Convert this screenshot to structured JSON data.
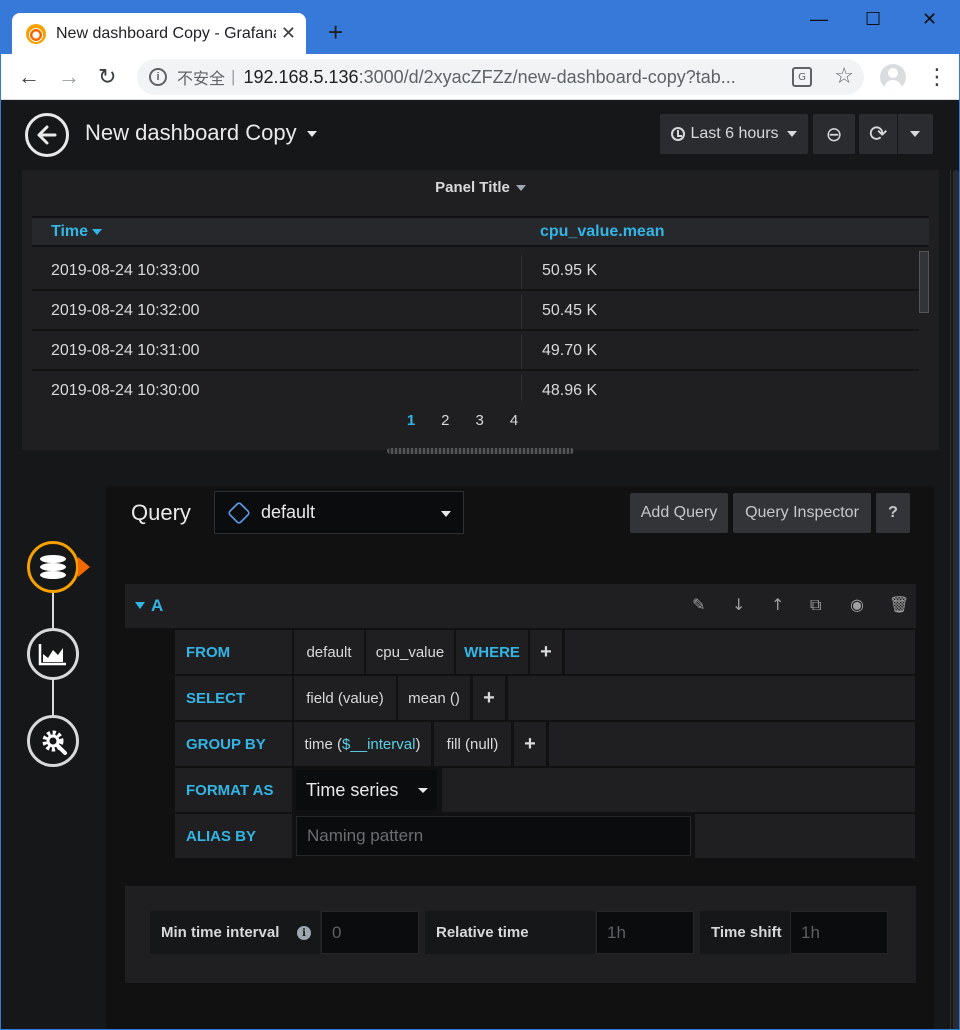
{
  "browser": {
    "tab_title": "New dashboard Copy - Grafana",
    "new_tab_symbol": "+",
    "tab_close_symbol": "✕",
    "win_min": "—",
    "win_max": "☐",
    "win_close": "✕",
    "nav_back": "←",
    "nav_forward": "→",
    "nav_reload": "↻",
    "security_label": "不安全",
    "separator": "|",
    "url_host": "192.168.5.136",
    "url_rest": ":3000/d/2xyacZFZz/new-dashboard-copy?tab...",
    "star": "☆",
    "menu": "⋮",
    "translate_glyph": "G"
  },
  "navbar": {
    "dashboard_title": "New dashboard Copy",
    "time_range_label": "Last 6 hours",
    "zoom_glyph": "⊖",
    "refresh_glyph": "⟳"
  },
  "panel": {
    "title": "Panel Title",
    "columns": [
      "Time",
      "cpu_value.mean"
    ],
    "rows": [
      [
        "2019-08-24 10:33:00",
        "50.95 K"
      ],
      [
        "2019-08-24 10:32:00",
        "50.45 K"
      ],
      [
        "2019-08-24 10:31:00",
        "49.70 K"
      ],
      [
        "2019-08-24 10:30:00",
        "48.96 K"
      ]
    ],
    "pages": [
      "1",
      "2",
      "3",
      "4"
    ],
    "active_page": "1"
  },
  "editor": {
    "section_label": "Query",
    "datasource": "default",
    "add_query": "Add Query",
    "query_inspector": "Query Inspector",
    "help": "?",
    "query": {
      "ref_id": "A",
      "actions": [
        "✎",
        "↓",
        "↑",
        "⧉",
        "◉",
        "🗑"
      ],
      "from_label": "FROM",
      "from_policy": "default",
      "from_measurement": "cpu_value",
      "where_label": "WHERE",
      "plus": "+",
      "select_label": "SELECT",
      "select_field": "field (value)",
      "select_agg": "mean ()",
      "group_label": "GROUP BY",
      "group_time_prefix": "time (",
      "group_time_var": "$__interval",
      "group_time_suffix": ")",
      "group_fill": "fill (null)",
      "format_label": "FORMAT AS",
      "format_value": "Time series",
      "alias_label": "ALIAS BY",
      "alias_placeholder": "Naming pattern"
    },
    "options": {
      "min_interval_label": "Min time interval",
      "min_interval_placeholder": "0",
      "info_glyph": "i",
      "relative_time_label": "Relative time",
      "relative_time_placeholder": "1h",
      "time_shift_label": "Time shift",
      "time_shift_placeholder": "1h"
    }
  }
}
